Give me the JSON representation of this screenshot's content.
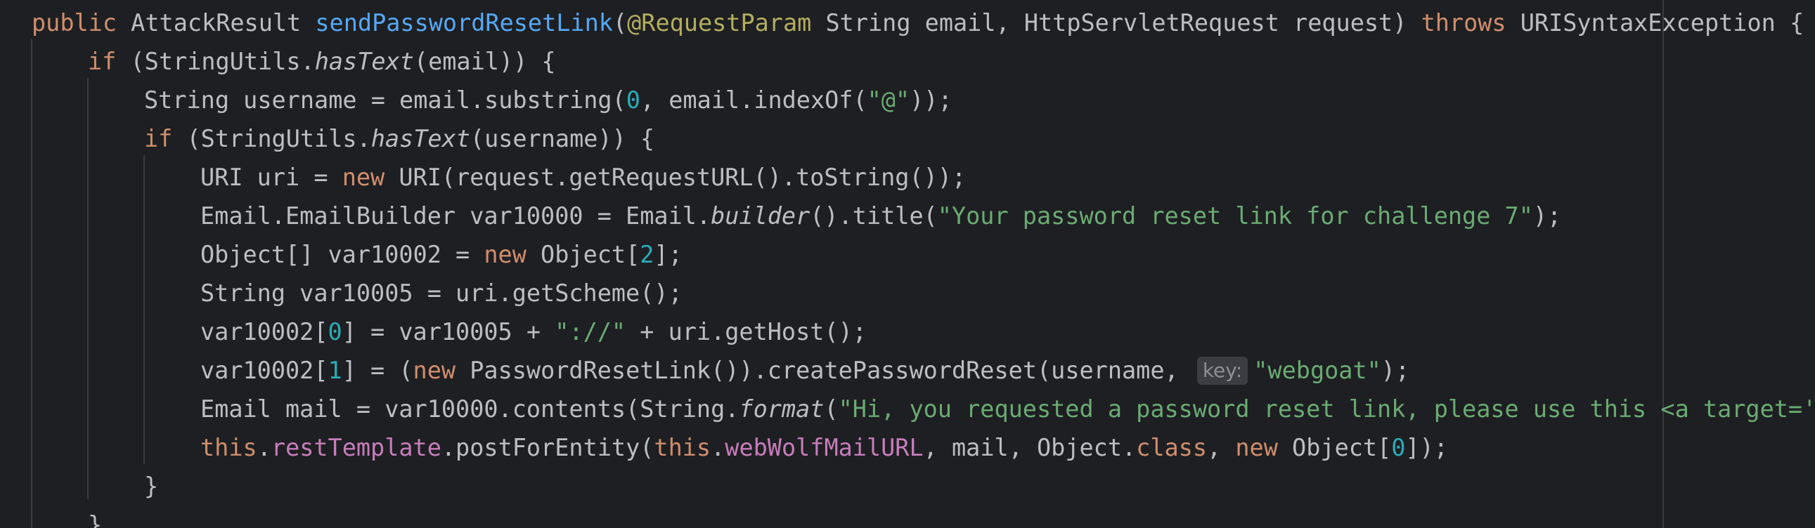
{
  "code": {
    "l0": {
      "public": "public",
      "type": " AttackResult ",
      "method": "sendPasswordResetLink",
      "paren": "(",
      "annotation": "@RequestParam",
      "params": " String email, HttpServletRequest request) ",
      "throws": "throws",
      "rest": " URISyntaxException {"
    },
    "l1": {
      "if": "if",
      "a": " (StringUtils.",
      "hasText": "hasText",
      "b": "(email)) {"
    },
    "l2": {
      "a": "String username = email.substring(",
      "zero": "0",
      "b": ", email.indexOf(",
      "at": "\"@\"",
      "c": "));"
    },
    "l3": {
      "if": "if",
      "a": " (StringUtils.",
      "hasText": "hasText",
      "b": "(username)) {"
    },
    "l4": {
      "a": "URI uri = ",
      "new": "new",
      "b": " URI(request.getRequestURL().toString());"
    },
    "l5": {
      "a": "Email.EmailBuilder var10000 = Email.",
      "builder": "builder",
      "b": "().title(",
      "str": "\"Your password reset link for challenge 7\"",
      "c": ");"
    },
    "l6": {
      "a": "Object[] var10002 = ",
      "new": "new",
      "b": " Object[",
      "num": "2",
      "c": "];"
    },
    "l7": {
      "a": "String var10005 = uri.getScheme();"
    },
    "l8": {
      "a": "var10002[",
      "num": "0",
      "b": "] = var10005 + ",
      "str": "\"://\"",
      "c": " + uri.getHost();"
    },
    "l9": {
      "a": "var10002[",
      "num": "1",
      "b": "] = (",
      "new": "new",
      "c": " PasswordResetLink()).createPasswordReset(username, ",
      "hint": "key:",
      "str": "\"webgoat\"",
      "d": ");"
    },
    "l10": {
      "a": "Email mail = var10000.contents(String.",
      "format": "format",
      "b": "(",
      "str": "\"Hi, you requested a password reset link, please use this <a target='_"
    },
    "l11": {
      "this1": "this",
      "dot1": ".",
      "field1": "restTemplate",
      "a": ".postForEntity(",
      "this2": "this",
      "dot2": ".",
      "field2": "webWolfMailURL",
      "b": ", mail, Object.",
      "class": "class",
      "c": ", ",
      "new": "new",
      "d": " Object[",
      "num": "0",
      "e": "]);"
    },
    "l12": {
      "brace": "}"
    },
    "l13": {
      "brace": "}"
    }
  },
  "colors": {
    "background": "#1e1f22",
    "text": "#bcbec4",
    "keyword": "#cf8e6d",
    "method": "#56a8f5",
    "annotation": "#b3ae60",
    "string": "#6aab73",
    "number": "#2aacb8",
    "field": "#c77dbb"
  }
}
